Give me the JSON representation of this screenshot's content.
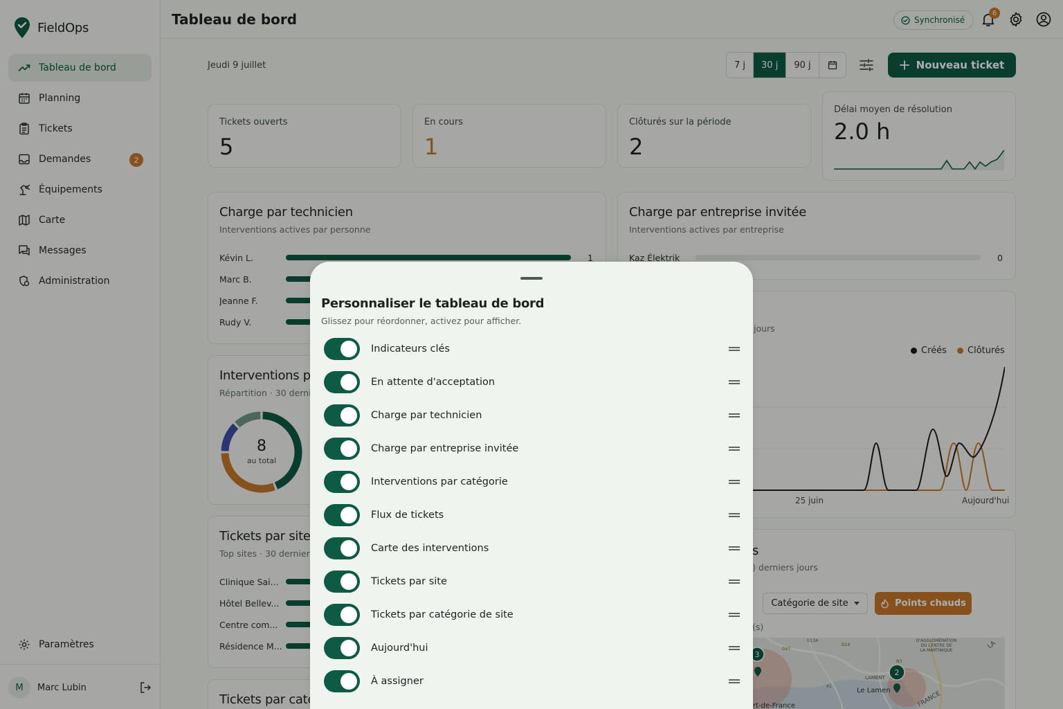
{
  "app": {
    "name": "FieldOps",
    "page_title": "Tableau de bord",
    "sync_status": "Synchronisé",
    "notification_count": "6"
  },
  "sidebar": {
    "items": [
      {
        "label": "Tableau de bord",
        "icon": "trending-up-icon",
        "active": true
      },
      {
        "label": "Planning",
        "icon": "calendar-icon"
      },
      {
        "label": "Tickets",
        "icon": "clipboard-icon"
      },
      {
        "label": "Demandes",
        "icon": "inbox-icon",
        "badge": "2"
      },
      {
        "label": "Équipements",
        "icon": "robot-arm-icon"
      },
      {
        "label": "Carte",
        "icon": "map-icon"
      },
      {
        "label": "Messages",
        "icon": "chat-icon"
      },
      {
        "label": "Administration",
        "icon": "admin-shield-icon"
      }
    ],
    "settings_label": "Paramètres",
    "user": {
      "initial": "M",
      "name": "Marc Lubin"
    }
  },
  "toolbar": {
    "date": "Jeudi 9 juillet",
    "ranges": [
      "7 j",
      "30 j",
      "90 j"
    ],
    "active_range": "30 j",
    "new_ticket_label": "Nouveau ticket"
  },
  "kpis": [
    {
      "label": "Tickets ouverts",
      "value": "5"
    },
    {
      "label": "En cours",
      "value": "1"
    },
    {
      "label": "Clôturés sur la période",
      "value": "2"
    },
    {
      "label": "Délai moyen de résolution",
      "value": "2.0 h"
    }
  ],
  "technician_load": {
    "title": "Charge par technicien",
    "subtitle": "Interventions actives par personne",
    "rows": [
      {
        "name": "Kévin L.",
        "value": 1,
        "label": "1"
      },
      {
        "name": "Marc B.",
        "value": 1
      },
      {
        "name": "Jeanne F.",
        "value": 1
      },
      {
        "name": "Rudy V.",
        "value": 1
      }
    ],
    "max": 1
  },
  "company_load": {
    "title": "Charge par entreprise invitée",
    "subtitle": "Interventions actives par entreprise",
    "rows": [
      {
        "name": "Kaz Élektrik",
        "value": 0,
        "label": "0"
      }
    ]
  },
  "categories_card": {
    "title": "Interventions pa",
    "subtitle": "Répartition · 30 dernie",
    "total": "8",
    "total_label": "au total",
    "slices": [
      {
        "value": 0.44,
        "color": "#0e5a45"
      },
      {
        "value": 0.31,
        "color": "#c7782c"
      },
      {
        "value": 0.13,
        "color": "#3f4fa8"
      },
      {
        "value": 0.12,
        "color": "#6f9a86"
      }
    ]
  },
  "flow_card": {
    "subtitle_fragment": "jours",
    "legend": [
      {
        "name": "Créés",
        "color": "#1b1b1b"
      },
      {
        "name": "Clôturés",
        "color": "#c7782c"
      }
    ],
    "x_labels": [
      "25 juin",
      "Aujourd'hui"
    ]
  },
  "sites_card": {
    "title": "Tickets par site",
    "subtitle": "Top sites · 30 derniers",
    "rows": [
      {
        "name": "Clinique Sai..."
      },
      {
        "name": "Hôtel Bellev..."
      },
      {
        "name": "Centre com..."
      },
      {
        "name": "Résidence M..."
      }
    ]
  },
  "map_card": {
    "title_fragment": "s",
    "subtitle_fragment": ") derniers jours",
    "filter_label": "Catégorie de site",
    "hotspot_label": "Points chauds",
    "count_fragment": "(s)",
    "map_labels": [
      "D'AGGLOMÉRATION",
      "DU CENTRE DE",
      "LA MARTINIQUE",
      "Le Lamen",
      "rt-de-France",
      "FRANCE",
      "LAMENT",
      "LA"
    ],
    "road_labels": [
      "D13A",
      "D14",
      "D47",
      "A1",
      "N3"
    ],
    "markers": [
      "3",
      "2"
    ]
  },
  "bottom_card": {
    "title": "Tickets par catég"
  },
  "sheet": {
    "title": "Personnaliser le tableau de bord",
    "subtitle": "Glissez pour réordonner, activez pour afficher.",
    "items": [
      {
        "label": "Indicateurs clés",
        "enabled": true
      },
      {
        "label": "En attente d'acceptation",
        "enabled": true
      },
      {
        "label": "Charge par technicien",
        "enabled": true
      },
      {
        "label": "Charge par entreprise invitée",
        "enabled": true
      },
      {
        "label": "Interventions par catégorie",
        "enabled": true
      },
      {
        "label": "Flux de tickets",
        "enabled": true
      },
      {
        "label": "Carte des interventions",
        "enabled": true
      },
      {
        "label": "Tickets par site",
        "enabled": true
      },
      {
        "label": "Tickets par catégorie de site",
        "enabled": true
      },
      {
        "label": "Aujourd'hui",
        "enabled": true
      },
      {
        "label": "À assigner",
        "enabled": true
      }
    ]
  },
  "colors": {
    "primary": "#0e5a45",
    "accent": "#c7782c",
    "background": "#f0f3ee"
  }
}
